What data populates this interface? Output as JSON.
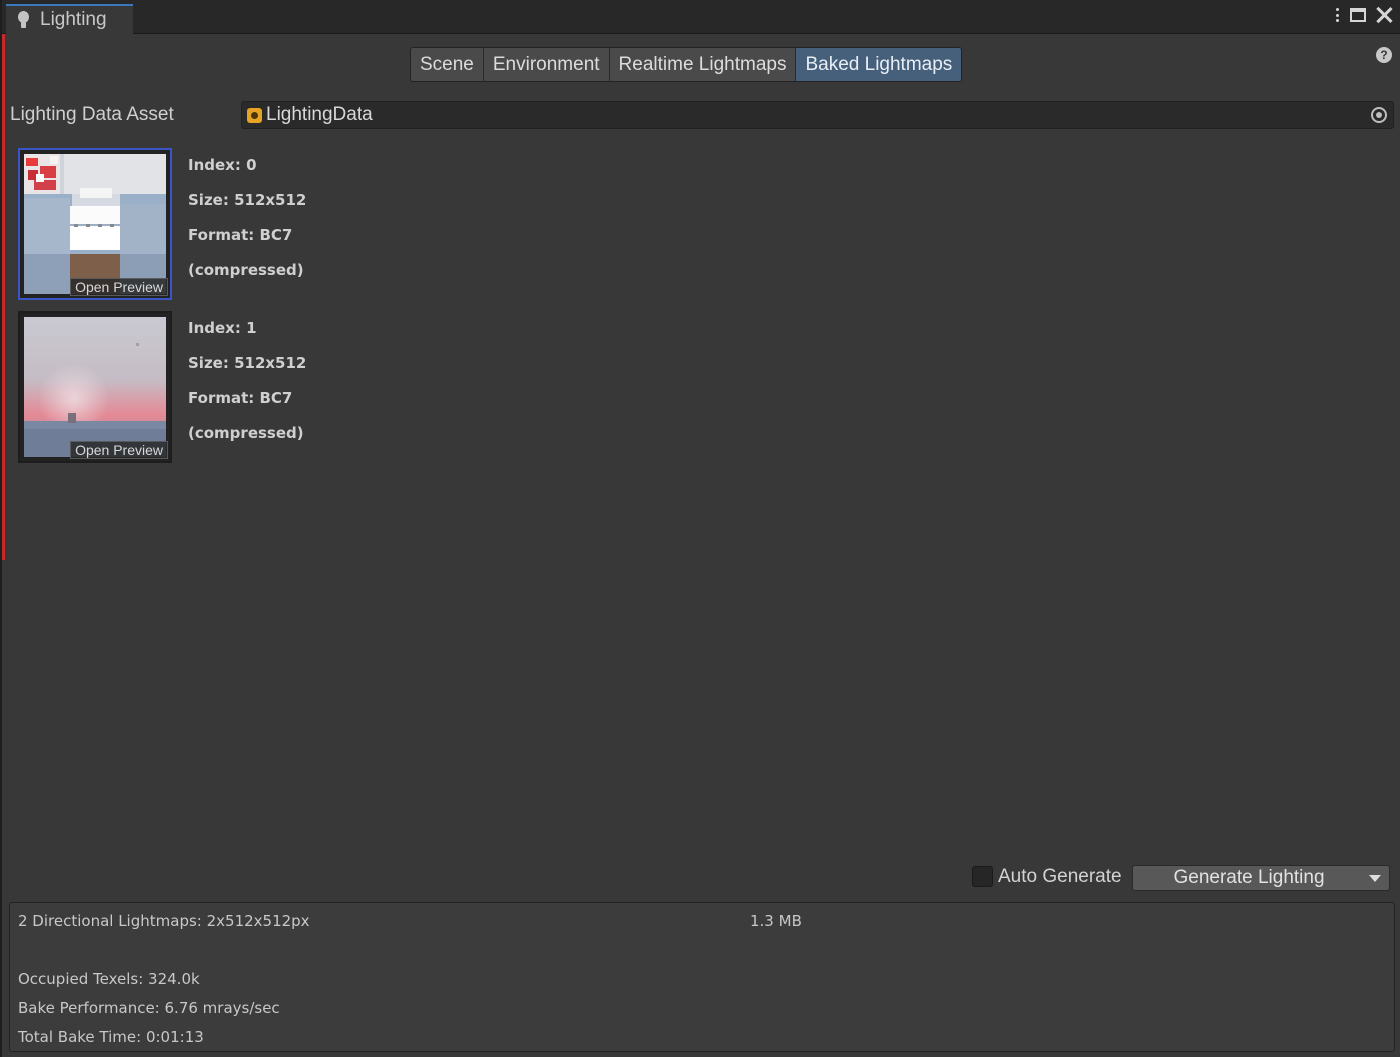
{
  "window": {
    "tab_title": "Lighting"
  },
  "tabs": [
    {
      "label": "Scene",
      "active": false
    },
    {
      "label": "Environment",
      "active": false
    },
    {
      "label": "Realtime Lightmaps",
      "active": false
    },
    {
      "label": "Baked Lightmaps",
      "active": true
    }
  ],
  "asset": {
    "label": "Lighting Data Asset",
    "value": "LightingData"
  },
  "lightmaps": [
    {
      "index": "Index: 0",
      "size": "Size: 512x512",
      "format": "Format: BC7 (compressed)",
      "preview_label": "Open Preview",
      "selected": true
    },
    {
      "index": "Index: 1",
      "size": "Size: 512x512",
      "format": "Format: BC7 (compressed)",
      "preview_label": "Open Preview",
      "selected": false
    }
  ],
  "controls": {
    "auto_generate_label": "Auto Generate",
    "auto_generate_checked": false,
    "generate_label": "Generate Lighting"
  },
  "stats": {
    "lightmaps": "2 Directional Lightmaps: 2x512x512px",
    "memory": "1.3 MB",
    "occupied": "Occupied Texels: 324.0k",
    "performance": "Bake Performance: 6.76 mrays/sec",
    "bake_time": "Total Bake Time: 0:01:13"
  },
  "colors": {
    "background": "#383838",
    "active_tab": "#46607c",
    "selected_border": "#3b55c7"
  }
}
